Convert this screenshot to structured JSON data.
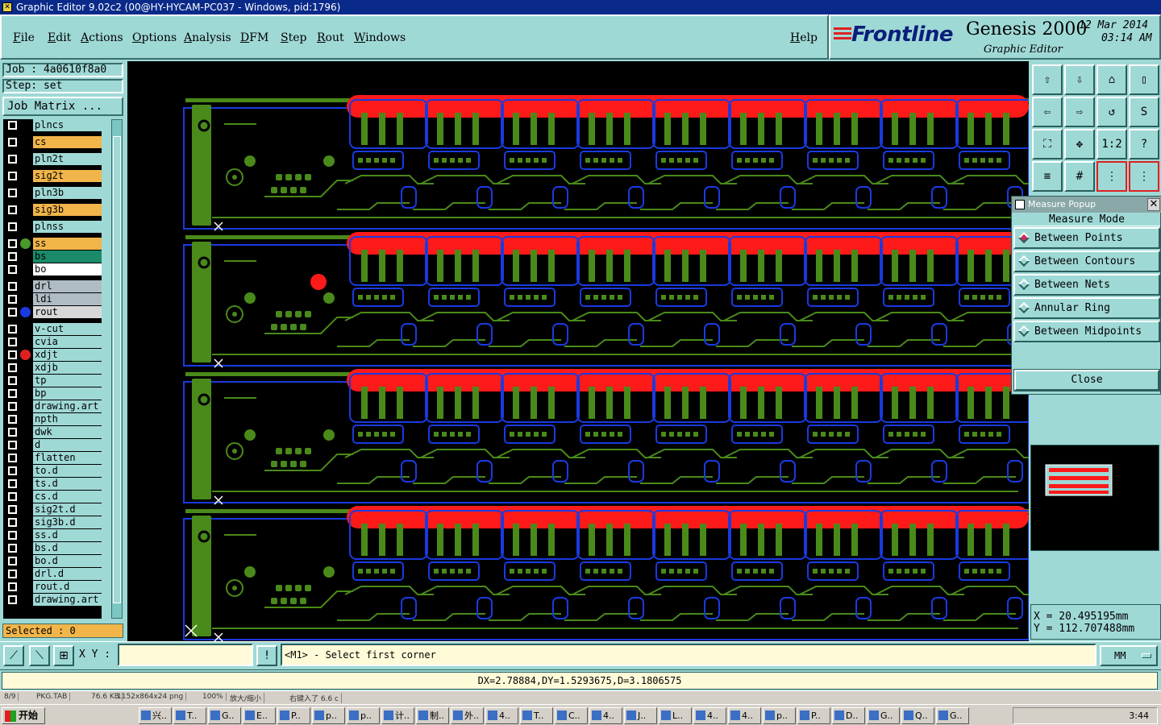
{
  "window": {
    "title": "Graphic Editor 9.02c2 (00@HY-HYCAM-PC037 - Windows, pid:1796)"
  },
  "menu": [
    {
      "label": "File"
    },
    {
      "label": "Edit"
    },
    {
      "label": "Actions"
    },
    {
      "label": "Options"
    },
    {
      "label": "Analysis"
    },
    {
      "label": "DFM"
    },
    {
      "label": "Step"
    },
    {
      "label": "Rout"
    },
    {
      "label": "Windows"
    }
  ],
  "help_label": "Help",
  "brand": {
    "logo": "Frontline",
    "product": "Genesis 2000",
    "subtitle": "Graphic Editor",
    "date": "12 Mar 2014",
    "time": "03:14 AM"
  },
  "job": {
    "job_label": "Job : 4a0610f8a0",
    "step_label": "Step: set",
    "matrix_label": "Job Matrix ..."
  },
  "layers": [
    {
      "name": "plncs",
      "color": "#9fd9d6",
      "dot": ""
    },
    {
      "name": "cs",
      "color": "#f2b54a",
      "dot": ""
    },
    {
      "name": "pln2t",
      "color": "#9fd9d6",
      "dot": ""
    },
    {
      "name": "sig2t",
      "color": "#f2b54a",
      "dot": ""
    },
    {
      "name": "pln3b",
      "color": "#9fd9d6",
      "dot": ""
    },
    {
      "name": "sig3b",
      "color": "#f2b54a",
      "dot": ""
    },
    {
      "name": "plnss",
      "color": "#9fd9d6",
      "dot": ""
    },
    {
      "name": "ss",
      "color": "#f2b54a",
      "dot": "#4a9a2a"
    },
    {
      "name": "bs",
      "color": "#1a8a6a",
      "dot": ""
    },
    {
      "name": "bo",
      "color": "#ffffff",
      "dot": ""
    },
    {
      "name": "drl",
      "color": "#b0bcc4",
      "dot": ""
    },
    {
      "name": "ldi",
      "color": "#b0bcc4",
      "dot": ""
    },
    {
      "name": "rout",
      "color": "#d8d8d8",
      "dot": "#1a3ae0"
    },
    {
      "name": "v-cut",
      "color": "#9fd9d6",
      "dot": ""
    },
    {
      "name": "cvia",
      "color": "#9fd9d6",
      "dot": ""
    },
    {
      "name": "xdjt",
      "color": "#9fd9d6",
      "dot": "#e02020"
    },
    {
      "name": "xdjb",
      "color": "#9fd9d6",
      "dot": ""
    },
    {
      "name": "tp",
      "color": "#9fd9d6",
      "dot": ""
    },
    {
      "name": "bp",
      "color": "#9fd9d6",
      "dot": ""
    },
    {
      "name": "drawing.art",
      "color": "#9fd9d6",
      "dot": ""
    },
    {
      "name": "npth",
      "color": "#9fd9d6",
      "dot": ""
    },
    {
      "name": "dwk",
      "color": "#9fd9d6",
      "dot": ""
    },
    {
      "name": "d",
      "color": "#9fd9d6",
      "dot": ""
    },
    {
      "name": "flatten",
      "color": "#9fd9d6",
      "dot": ""
    },
    {
      "name": "to.d",
      "color": "#9fd9d6",
      "dot": ""
    },
    {
      "name": "ts.d",
      "color": "#9fd9d6",
      "dot": ""
    },
    {
      "name": "cs.d",
      "color": "#9fd9d6",
      "dot": ""
    },
    {
      "name": "sig2t.d",
      "color": "#9fd9d6",
      "dot": ""
    },
    {
      "name": "sig3b.d",
      "color": "#9fd9d6",
      "dot": ""
    },
    {
      "name": "ss.d",
      "color": "#9fd9d6",
      "dot": ""
    },
    {
      "name": "bs.d",
      "color": "#9fd9d6",
      "dot": ""
    },
    {
      "name": "bo.d",
      "color": "#9fd9d6",
      "dot": ""
    },
    {
      "name": "drl.d",
      "color": "#9fd9d6",
      "dot": ""
    },
    {
      "name": "rout.d",
      "color": "#9fd9d6",
      "dot": ""
    },
    {
      "name": "drawing.art",
      "color": "#9fd9d6",
      "dot": ""
    }
  ],
  "selected_label": "Selected : 0",
  "measure_popup": {
    "title": "Measure Popup",
    "mode_label": "Measure Mode",
    "options": [
      {
        "label": "Between Points",
        "selected": true
      },
      {
        "label": "Between Contours",
        "selected": false
      },
      {
        "label": "Between Nets",
        "selected": false
      },
      {
        "label": "Annular Ring",
        "selected": false
      },
      {
        "label": "Between Midpoints",
        "selected": false
      }
    ],
    "close_label": "Close"
  },
  "tool_labels": {
    "one_to_two": "1:2",
    "help": "?"
  },
  "coords": {
    "x": "X = 20.495195mm",
    "y": "Y = 112.707488mm"
  },
  "bottom": {
    "xy_label": "X Y :",
    "message": "<M1> - Select first corner",
    "units": "MM"
  },
  "delta": "DX=2.78884,DY=1.5293675,D=3.1806575",
  "statusstrip": [
    "8/9",
    "PKG.TAB",
    "76.6 KB",
    "1152x864x24 png",
    "100%",
    "放大/缩小",
    "右键入了 6.6 c"
  ],
  "taskbar": {
    "start": "开始",
    "items": [
      "兴..",
      "T..",
      "G..",
      "E..",
      "P..",
      "p..",
      "p..",
      "计..",
      "制..",
      "外..",
      "4..",
      "T..",
      "C..",
      "4..",
      "J..",
      "L..",
      "4..",
      "4..",
      "p..",
      "P..",
      "D..",
      "G..",
      "Q..",
      "G.."
    ],
    "clock": "3:44"
  },
  "colors": {
    "bg": "#9fd9d6",
    "canvas": "#000000",
    "copper": "#4a8a1a",
    "mask": "#ff1a1a",
    "rout": "#1a3ae0"
  }
}
